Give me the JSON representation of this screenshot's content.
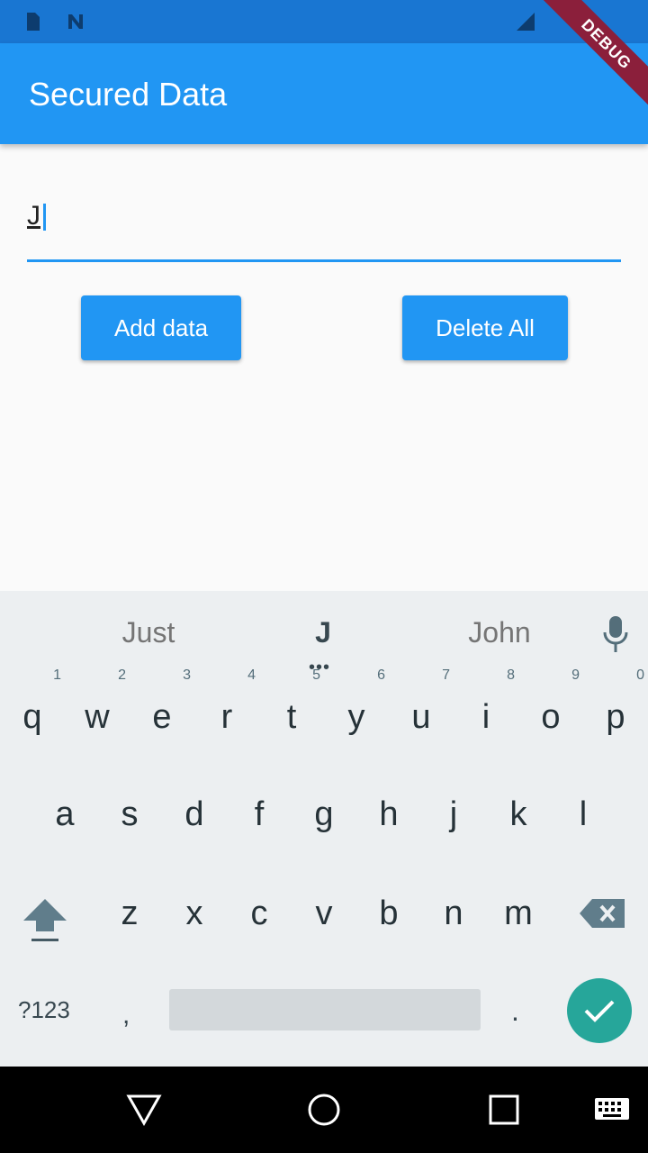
{
  "app": {
    "title": "Secured Data",
    "debug_label": "DEBUG"
  },
  "form": {
    "input_value": "J",
    "add_button": "Add data",
    "delete_button": "Delete All"
  },
  "keyboard": {
    "suggestions": [
      "Just",
      "J",
      "John"
    ],
    "row1": [
      {
        "key": "q",
        "hint": "1"
      },
      {
        "key": "w",
        "hint": "2"
      },
      {
        "key": "e",
        "hint": "3"
      },
      {
        "key": "r",
        "hint": "4"
      },
      {
        "key": "t",
        "hint": "5"
      },
      {
        "key": "y",
        "hint": "6"
      },
      {
        "key": "u",
        "hint": "7"
      },
      {
        "key": "i",
        "hint": "8"
      },
      {
        "key": "o",
        "hint": "9"
      },
      {
        "key": "p",
        "hint": "0"
      }
    ],
    "row2": [
      "a",
      "s",
      "d",
      "f",
      "g",
      "h",
      "j",
      "k",
      "l"
    ],
    "row3": [
      "z",
      "x",
      "c",
      "v",
      "b",
      "n",
      "m"
    ],
    "symbols_key": "?123",
    "comma_key": ",",
    "period_key": "."
  },
  "colors": {
    "primary": "#2196f3",
    "status_bar": "#1976d2",
    "enter_key": "#26a69a"
  },
  "icons": [
    "sim-icon",
    "notification-icon",
    "signal-icon",
    "mic-icon",
    "shift-icon",
    "backspace-icon",
    "check-icon",
    "back-icon",
    "home-icon",
    "recents-icon",
    "keyboard-switch-icon"
  ]
}
